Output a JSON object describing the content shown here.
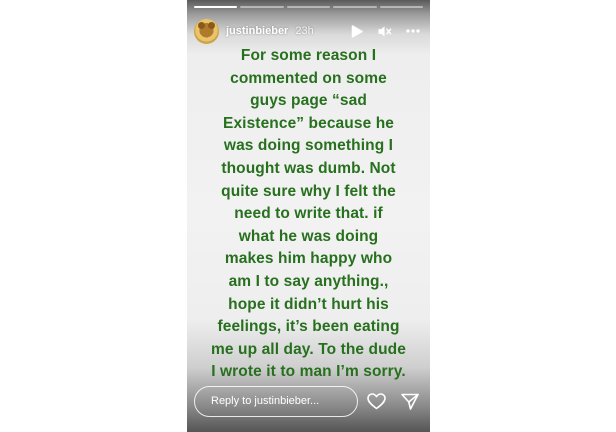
{
  "story": {
    "progress": {
      "segments": 5,
      "active_index": 0
    },
    "header": {
      "username": "justinbieber",
      "time": "23h",
      "icons": [
        "play-icon",
        "mute-icon",
        "more-icon"
      ]
    },
    "caption_lines": [
      "For some reason I",
      "commented on some",
      "guys page “sad",
      "Existence” because he",
      "was doing something I",
      "thought was dumb.  Not",
      "quite sure why I felt the",
      "need to write that.  if",
      "what he was doing",
      "makes him happy who",
      "am I to say anything.,",
      "hope it didn’t hurt his",
      "feelings, it’s been eating",
      "me up all day. To the dude",
      "I wrote it to man I’m sorry."
    ],
    "reply": {
      "placeholder": "Reply to justinbieber..."
    },
    "footer_icons": [
      "heart-icon",
      "send-icon"
    ],
    "colors": {
      "caption": "#27701e",
      "ui": "#ffffff"
    }
  }
}
